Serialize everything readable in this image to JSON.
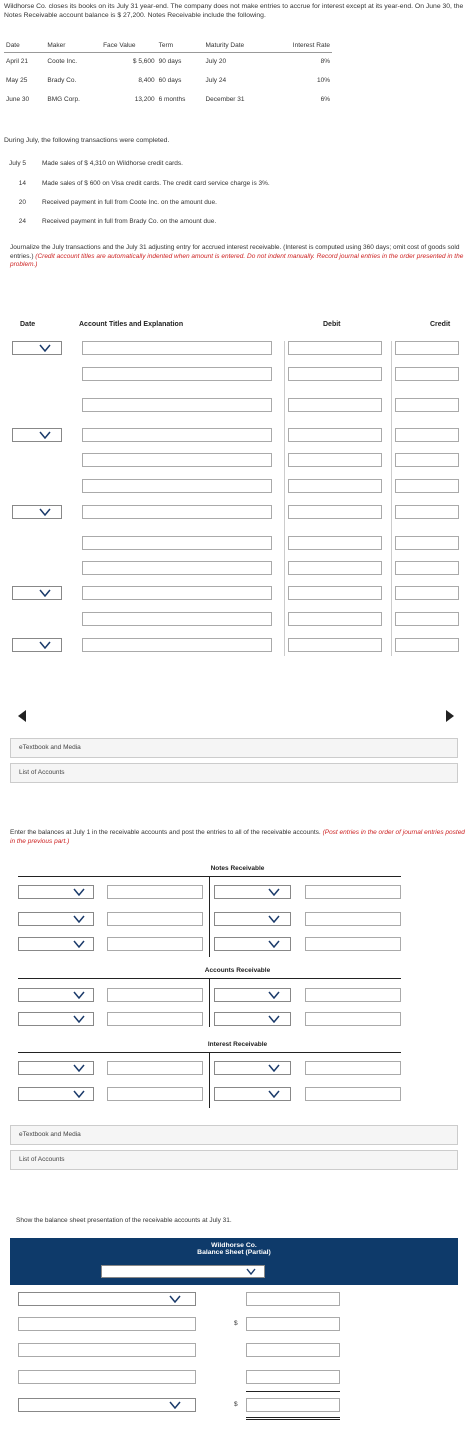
{
  "intro": "Wildhorse Co. closes its books on its July 31 year-end. The company does not make entries to accrue for interest except at its year-end. On June 30, the Notes Receivable account balance is $ 27,200. Notes Receivable include the following.",
  "notes_table": {
    "headers": [
      "Date",
      "Maker",
      "Face Value",
      "Term",
      "Maturity Date",
      "Interest Rate"
    ],
    "rows": [
      [
        "April 21",
        "Coote Inc.",
        "$ 5,600",
        "90 days",
        "July 20",
        "8%"
      ],
      [
        "May 25",
        "Brady Co.",
        "8,400",
        "60 days",
        "July 24",
        "10%"
      ],
      [
        "June 30",
        "BMG Corp.",
        "13,200",
        "6 months",
        "December 31",
        "6%"
      ]
    ]
  },
  "during_text": "During July, the following transactions were completed.",
  "transactions": [
    {
      "day": "July 5",
      "text": "Made sales of $ 4,310 on Wildhorse credit cards."
    },
    {
      "day": "14",
      "text": "Made sales of $ 600 on Visa credit cards. The credit card service charge is 3%."
    },
    {
      "day": "20",
      "text": "Received payment in full from Coote Inc. on the amount due."
    },
    {
      "day": "24",
      "text": "Received payment in full from Brady Co. on the amount due."
    }
  ],
  "journal": {
    "instruction": "Journalize the July transactions and the July 31 adjusting entry for accrued interest receivable. (Interest is computed using 360 days; omit cost of goods sold entries.)",
    "instruction_red": "(Credit account titles are automatically indented when amount is entered. Do not indent manually. Record journal entries in the order presented in the problem.)",
    "col_date": "Date",
    "col_account": "Account Titles and Explanation",
    "col_debit": "Debit",
    "col_credit": "Credit"
  },
  "links": {
    "etextbook": "eTextbook and Media",
    "list_accounts": "List of Accounts"
  },
  "post": {
    "instruction": "Enter the balances at July 1 in the receivable accounts and post the entries to all of the receivable accounts.",
    "instruction_red": "(Post entries in the order of journal entries posted in the previous part.)",
    "t_notes": "Notes Receivable",
    "t_accounts": "Accounts Receivable",
    "t_interest": "Interest Receivable"
  },
  "balance": {
    "instruction": "Show the balance sheet presentation of the receivable accounts at July 31.",
    "company": "Wildhorse Co.",
    "title": "Balance Sheet (Partial)",
    "dollar": "$"
  },
  "colors": {
    "banner": "#0e3a6a",
    "accent_red": "#cc2222",
    "chevron": "#1a3a6a"
  }
}
